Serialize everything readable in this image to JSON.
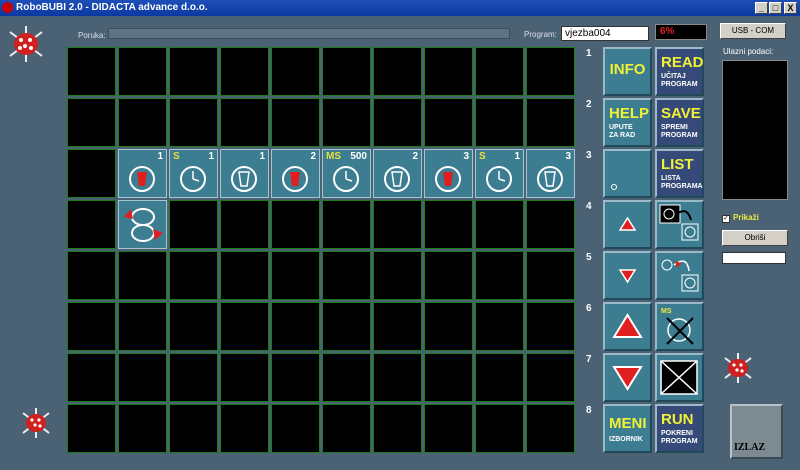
{
  "window": {
    "title": "RoboBUBI 2.0 - DIDACTA advance d.o.o.",
    "min": "_",
    "max": "□",
    "close": "X"
  },
  "header": {
    "poruka_label": "Poruka:",
    "program_label": "Program:",
    "program_value": "vjezba004",
    "progress_text": "6%",
    "usb_button": "USB - COM"
  },
  "grid": {
    "row3": [
      {
        "tl": "",
        "tr": ""
      },
      {
        "tl": "",
        "tr": "1",
        "icon": "cup-red-icon"
      },
      {
        "tl": "S",
        "tr": "1",
        "icon": "clock-icon"
      },
      {
        "tl": "",
        "tr": "1",
        "icon": "cup-white-icon"
      },
      {
        "tl": "",
        "tr": "2",
        "icon": "cup-red-icon"
      },
      {
        "tl": "MS",
        "tr": "500",
        "icon": "clock-icon"
      },
      {
        "tl": "",
        "tr": "2",
        "icon": "cup-white-icon"
      },
      {
        "tl": "",
        "tr": "3",
        "icon": "cup-red-icon"
      },
      {
        "tl": "S",
        "tr": "1",
        "icon": "clock-icon"
      },
      {
        "tl": "",
        "tr": "3",
        "icon": "cup-white-icon"
      }
    ]
  },
  "row_numbers": [
    "1",
    "2",
    "3",
    "4",
    "5",
    "6",
    "7",
    "8"
  ],
  "buttons": {
    "info": "INFO",
    "read": "READ",
    "read_sub1": "UČITAJ",
    "read_sub2": "PROGRAM",
    "help": "HELP",
    "help_sub1": "UPUTE",
    "help_sub2": "ZA RAD",
    "save": "SAVE",
    "save_sub1": "SPREMI",
    "save_sub2": "PROGRAM",
    "list": "LIST",
    "list_sub1": "LISTA",
    "list_sub2": "PROGRAMA",
    "meni": "MENI",
    "meni_sub": "IZBORNIK",
    "run": "RUN",
    "run_sub1": "POKRENI",
    "run_sub2": "PROGRAM",
    "ms_label": "MS"
  },
  "right_panel": {
    "input_label": "Ulazni podaci:",
    "prikazi_label": "Prikaži",
    "obrisi_button": "Obriši",
    "izlaz_button": "IZLAZ"
  }
}
